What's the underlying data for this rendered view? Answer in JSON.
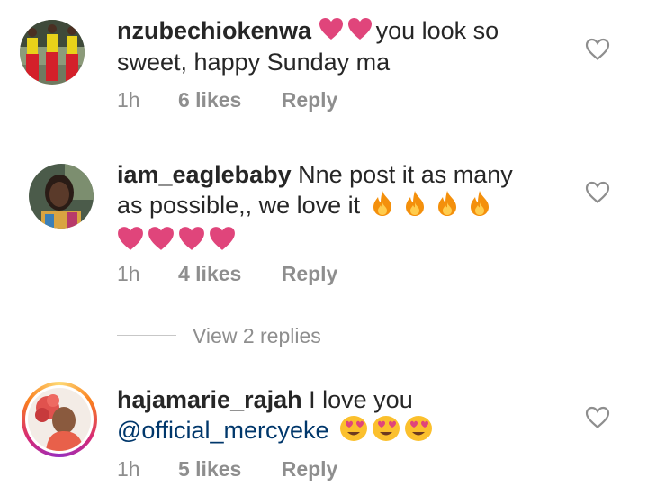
{
  "comments": [
    {
      "username": "nzubechiokenwa",
      "text_after_emoji": "you look so sweet, happy Sunday ma",
      "inline_emojis": [
        "pink-heart",
        "pink-heart"
      ],
      "time": "1h",
      "likes": "6 likes",
      "reply": "Reply"
    },
    {
      "username": "iam_eaglebaby",
      "text": "Nne post it as many as possible,, we love it",
      "inline_emojis": [
        "fire",
        "fire",
        "fire",
        "fire"
      ],
      "trailing_emojis": [
        "pink-heart",
        "pink-heart",
        "pink-heart",
        "pink-heart"
      ],
      "time": "1h",
      "likes": "4 likes",
      "reply": "Reply"
    },
    {
      "username": "hajamarie_rajah",
      "text": "I love you",
      "mention": "@official_mercyeke",
      "inline_emojis": [
        "heart-eyes",
        "heart-eyes",
        "heart-eyes"
      ],
      "time": "1h",
      "likes": "5 likes",
      "reply": "Reply",
      "has_story_ring": true
    }
  ],
  "view_replies": "View 2 replies",
  "colors": {
    "text": "#262626",
    "meta": "#8e8e8e",
    "mention": "#00376b",
    "heart_emoji": "#e0457b",
    "fire_emoji": "#f4900c"
  },
  "icons": {
    "like": "heart-outline-icon"
  }
}
